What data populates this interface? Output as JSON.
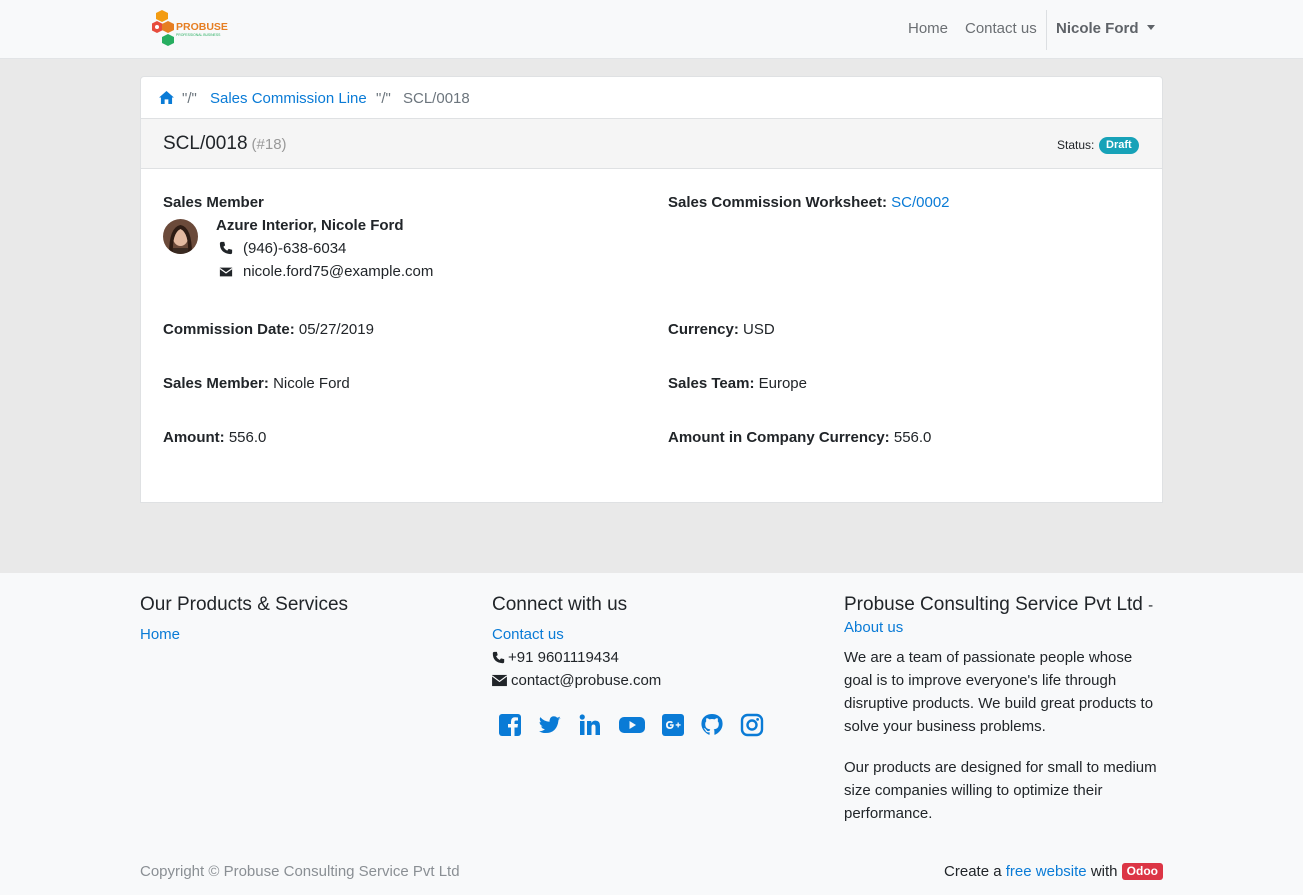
{
  "navbar": {
    "logo_text": "PROBUSE",
    "logo_subtext": "PROFESSIONAL BUSINESS",
    "home": "Home",
    "contact": "Contact us",
    "user": "Nicole Ford"
  },
  "breadcrumb": {
    "sep": "\"/\"",
    "link": "Sales Commission Line",
    "current": "SCL/0018"
  },
  "record": {
    "title": "SCL/0018",
    "id": "(#18)",
    "status_label": "Status:",
    "status": "Draft"
  },
  "details": {
    "sales_member_heading": "Sales Member",
    "partner_name": "Azure Interior, Nicole Ford",
    "phone": "(946)-638-6034",
    "email": "nicole.ford75@example.com",
    "worksheet_label": "Sales Commission Worksheet:",
    "worksheet_value": "SC/0002",
    "commission_date_label": "Commission Date:",
    "commission_date_value": "05/27/2019",
    "currency_label": "Currency:",
    "currency_value": "USD",
    "sales_member_label": "Sales Member:",
    "sales_member_value": "Nicole Ford",
    "sales_team_label": "Sales Team:",
    "sales_team_value": "Europe",
    "amount_label": "Amount:",
    "amount_value": "556.0",
    "amount_company_label": "Amount in Company Currency:",
    "amount_company_value": "556.0"
  },
  "footer": {
    "products_heading": "Our Products & Services",
    "products_home": "Home",
    "connect_heading": "Connect with us",
    "connect_contact": "Contact us",
    "phone": "+91 9601119434",
    "email": "contact@probuse.com",
    "company_heading": "Probuse Consulting Service Pvt Ltd",
    "company_dash": "-",
    "about": "About us",
    "para1": "We are a team of passionate people whose goal is to improve everyone's life through disruptive products. We build great products to solve your business problems.",
    "para2": "Our products are designed for small to medium size companies willing to optimize their performance.",
    "copyright": "Copyright © Probuse Consulting Service Pvt Ltd",
    "credit_prefix": "Create a",
    "credit_link": "free website",
    "credit_with": "with",
    "credit_badge": "Odoo"
  },
  "icons": [
    "home-icon",
    "phone-icon",
    "envelope-icon",
    "facebook-icon",
    "twitter-icon",
    "linkedin-icon",
    "youtube-icon",
    "google-plus-icon",
    "github-icon",
    "instagram-icon"
  ],
  "colors": {
    "link": "#0a7bd6",
    "status_badge": "#17a2b8",
    "odoo_badge": "#dc3545"
  }
}
